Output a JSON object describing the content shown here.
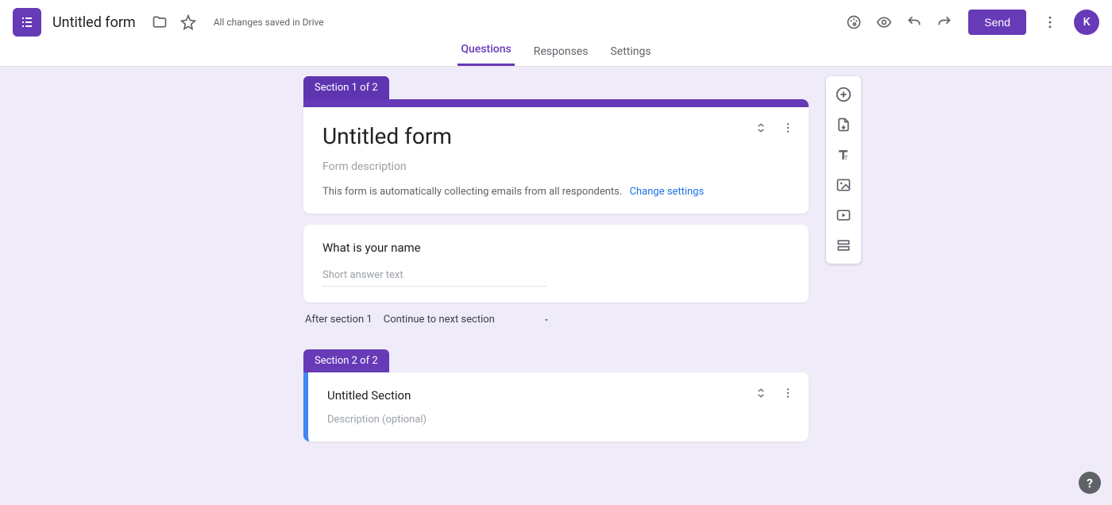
{
  "header": {
    "form_title": "Untitled form",
    "save_status": "All changes saved in Drive",
    "send_label": "Send",
    "avatar_initial": "K"
  },
  "tabs": {
    "questions": "Questions",
    "responses": "Responses",
    "settings": "Settings"
  },
  "section1": {
    "badge": "Section 1 of 2",
    "title": "Untitled form",
    "description_placeholder": "Form description",
    "email_notice": "This form is automatically collecting emails from all respondents.",
    "change_settings": "Change settings"
  },
  "question1": {
    "title": "What is your name",
    "answer_placeholder": "Short answer text"
  },
  "after_section": {
    "label": "After section 1",
    "option": "Continue to next section"
  },
  "section2": {
    "badge": "Section 2 of 2",
    "title": "Untitled Section",
    "description_placeholder": "Description (optional)"
  }
}
